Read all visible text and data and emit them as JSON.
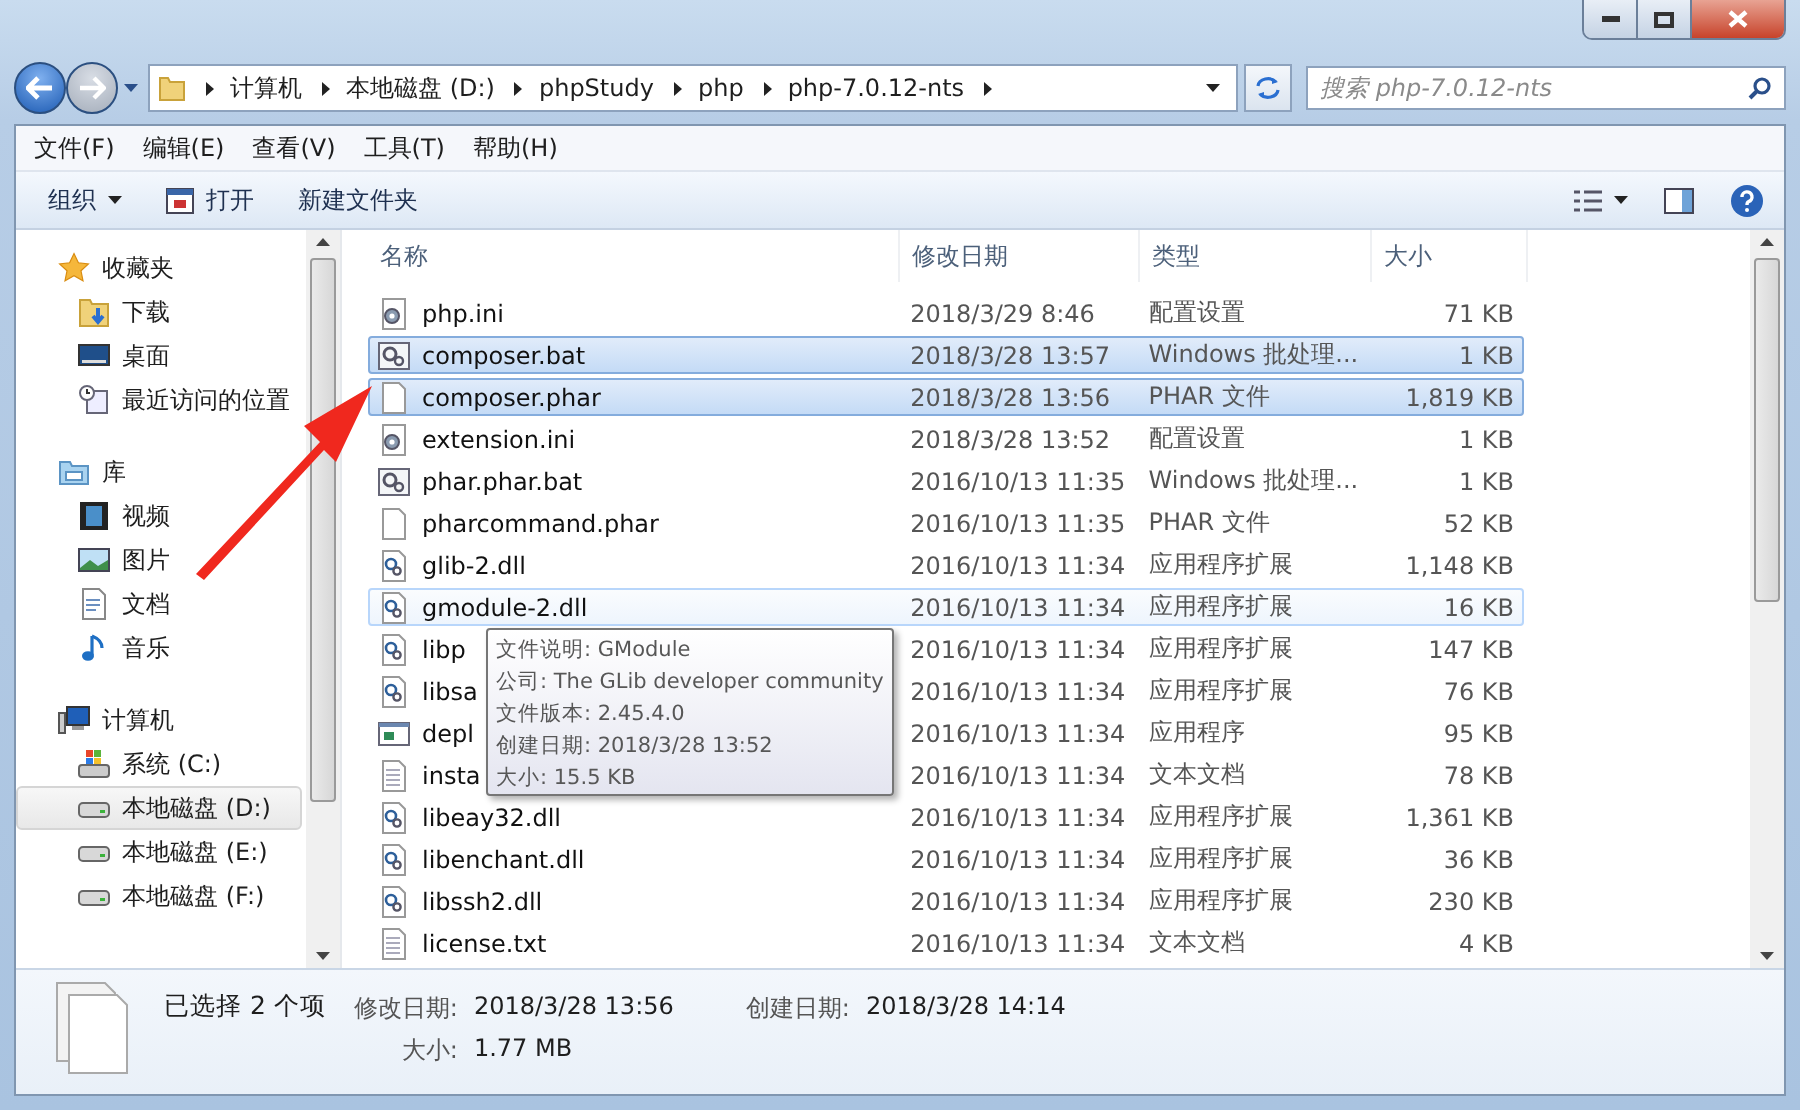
{
  "address": {
    "crumbs": [
      "计算机",
      "本地磁盘 (D:)",
      "phpStudy",
      "php",
      "php-7.0.12-nts"
    ]
  },
  "search": {
    "placeholder": "搜索 php-7.0.12-nts"
  },
  "menu": [
    "文件(F)",
    "编辑(E)",
    "查看(V)",
    "工具(T)",
    "帮助(H)"
  ],
  "commands": [
    {
      "label": "组织",
      "kind": "dropdown"
    },
    {
      "label": "打开",
      "kind": "open"
    },
    {
      "label": "新建文件夹",
      "kind": "plain"
    }
  ],
  "sidebar": [
    {
      "label": "收藏夹",
      "kind": "star",
      "children": [
        {
          "label": "下载",
          "kind": "download",
          "selected": false
        },
        {
          "label": "桌面",
          "kind": "desktop",
          "selected": false
        },
        {
          "label": "最近访问的位置",
          "kind": "recent",
          "selected": false
        }
      ]
    },
    {
      "label": "库",
      "kind": "library",
      "children": [
        {
          "label": "视频",
          "kind": "video",
          "selected": false
        },
        {
          "label": "图片",
          "kind": "picture",
          "selected": false
        },
        {
          "label": "文档",
          "kind": "document",
          "selected": false
        },
        {
          "label": "音乐",
          "kind": "music",
          "selected": false
        }
      ]
    },
    {
      "label": "计算机",
      "kind": "computer",
      "children": [
        {
          "label": "系统 (C:)",
          "kind": "sysdrive",
          "selected": false
        },
        {
          "label": "本地磁盘 (D:)",
          "kind": "drive",
          "selected": true
        },
        {
          "label": "本地磁盘 (E:)",
          "kind": "drive",
          "selected": false
        },
        {
          "label": "本地磁盘 (F:)",
          "kind": "drive",
          "selected": false
        }
      ]
    }
  ],
  "table": {
    "columns": [
      "名称",
      "修改日期",
      "类型",
      "大小"
    ],
    "rows": [
      {
        "name": "php.ini",
        "date": "2018/3/29 8:46",
        "type": "配置设置",
        "size": "71 KB",
        "kind": "ini",
        "selected": false,
        "hovered": false
      },
      {
        "name": "composer.bat",
        "date": "2018/3/28 13:57",
        "type": "Windows 批处理...",
        "size": "1 KB",
        "kind": "bat",
        "selected": true,
        "hovered": false
      },
      {
        "name": "composer.phar",
        "date": "2018/3/28 13:56",
        "type": "PHAR 文件",
        "size": "1,819 KB",
        "kind": "blank",
        "selected": true,
        "hovered": false
      },
      {
        "name": "extension.ini",
        "date": "2018/3/28 13:52",
        "type": "配置设置",
        "size": "1 KB",
        "kind": "ini",
        "selected": false,
        "hovered": false
      },
      {
        "name": "phar.phar.bat",
        "date": "2016/10/13 11:35",
        "type": "Windows 批处理...",
        "size": "1 KB",
        "kind": "bat",
        "selected": false,
        "hovered": false
      },
      {
        "name": "pharcommand.phar",
        "date": "2016/10/13 11:35",
        "type": "PHAR 文件",
        "size": "52 KB",
        "kind": "blank",
        "selected": false,
        "hovered": false
      },
      {
        "name": "glib-2.dll",
        "date": "2016/10/13 11:34",
        "type": "应用程序扩展",
        "size": "1,148 KB",
        "kind": "dll",
        "selected": false,
        "hovered": false
      },
      {
        "name": "gmodule-2.dll",
        "date": "2016/10/13 11:34",
        "type": "应用程序扩展",
        "size": "16 KB",
        "kind": "dll",
        "selected": false,
        "hovered": true
      },
      {
        "name": "libp",
        "date": "2016/10/13 11:34",
        "type": "应用程序扩展",
        "size": "147 KB",
        "kind": "dll",
        "selected": false,
        "hovered": false
      },
      {
        "name": "libsa",
        "date": "2016/10/13 11:34",
        "type": "应用程序扩展",
        "size": "76 KB",
        "kind": "dll",
        "selected": false,
        "hovered": false
      },
      {
        "name": "depl",
        "date": "2016/10/13 11:34",
        "type": "应用程序",
        "size": "95 KB",
        "kind": "exe",
        "selected": false,
        "hovered": false
      },
      {
        "name": "insta",
        "date": "2016/10/13 11:34",
        "type": "文本文档",
        "size": "78 KB",
        "kind": "txt",
        "selected": false,
        "hovered": false
      },
      {
        "name": "libeay32.dll",
        "date": "2016/10/13 11:34",
        "type": "应用程序扩展",
        "size": "1,361 KB",
        "kind": "dll",
        "selected": false,
        "hovered": false
      },
      {
        "name": "libenchant.dll",
        "date": "2016/10/13 11:34",
        "type": "应用程序扩展",
        "size": "36 KB",
        "kind": "dll",
        "selected": false,
        "hovered": false
      },
      {
        "name": "libssh2.dll",
        "date": "2016/10/13 11:34",
        "type": "应用程序扩展",
        "size": "230 KB",
        "kind": "dll",
        "selected": false,
        "hovered": false
      },
      {
        "name": "license.txt",
        "date": "2016/10/13 11:34",
        "type": "文本文档",
        "size": "4 KB",
        "kind": "txt",
        "selected": false,
        "hovered": false
      }
    ]
  },
  "tooltip": [
    "文件说明: GModule",
    "公司: The GLib developer community",
    "文件版本: 2.45.4.0",
    "创建日期: 2018/3/28 13:52",
    "大小: 15.5 KB"
  ],
  "details": {
    "summary": "已选择 2 个项",
    "fields": [
      {
        "label": "修改日期:",
        "value": "2018/3/28 13:56"
      },
      {
        "label": "创建日期:",
        "value": "2018/3/28 14:14"
      },
      {
        "label": "大小:",
        "value": "1.77 MB"
      }
    ]
  }
}
